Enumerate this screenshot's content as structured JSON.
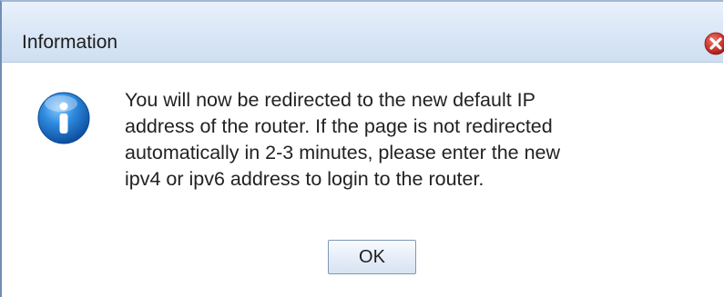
{
  "dialog": {
    "title": "Information",
    "message_lines": [
      "You will now be redirected to the new default IP",
      "address of the router. If the page is not redirected",
      "automatically in 2-3 minutes, please enter the new",
      "ipv4 or ipv6 address to login to the router."
    ],
    "ok_label": "OK",
    "icons": {
      "info": "info-icon",
      "close": "close-icon"
    },
    "colors": {
      "title_bar": "#d9e6f6",
      "info_icon": "#1f74c7",
      "close_icon": "#c8302b"
    }
  }
}
